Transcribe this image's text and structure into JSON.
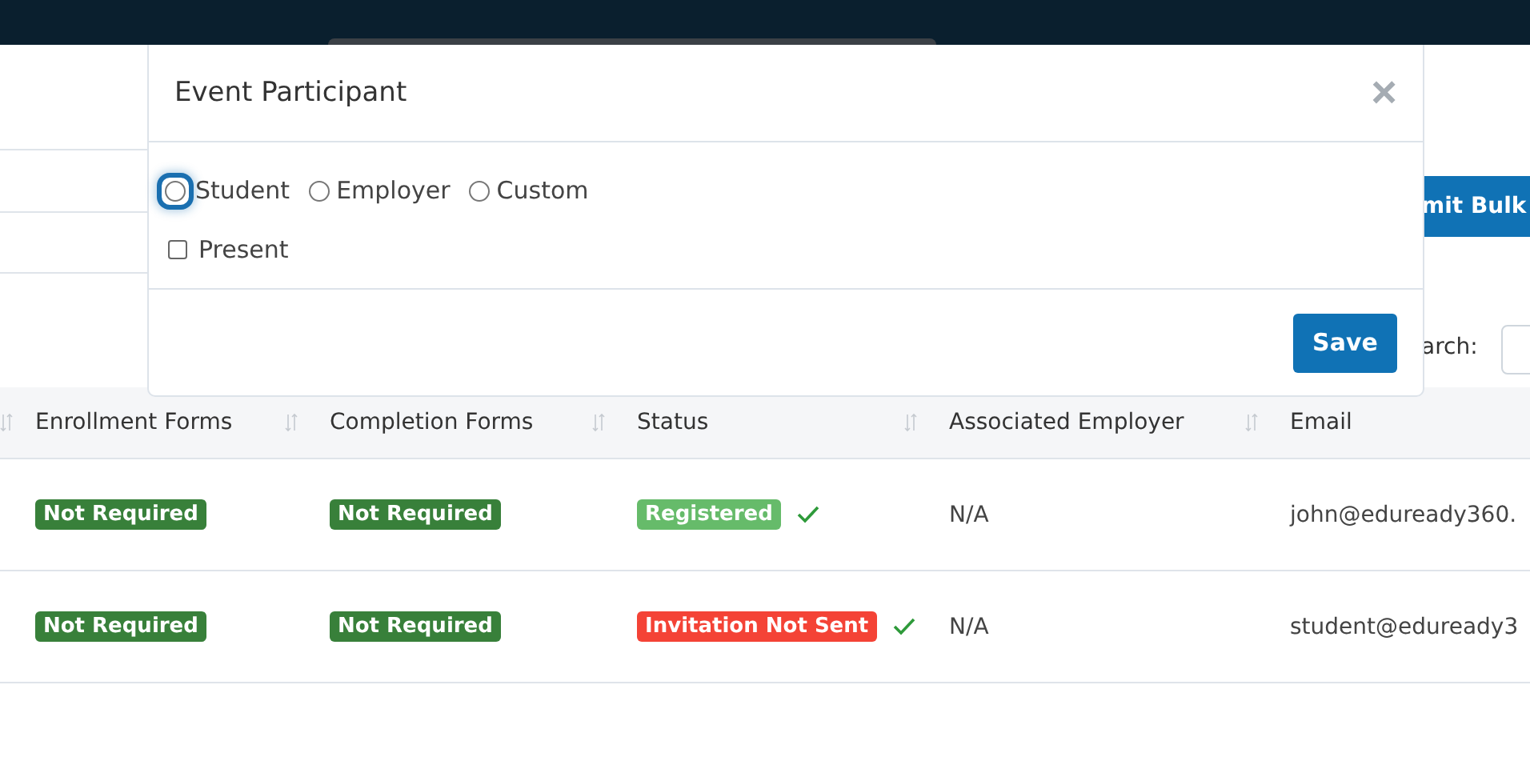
{
  "toolbar": {
    "submit_button": "mit Bulk",
    "search_label": "arch:"
  },
  "table": {
    "columns": [
      {
        "label": "Enrollment Forms"
      },
      {
        "label": "Completion Forms"
      },
      {
        "label": "Status"
      },
      {
        "label": "Associated Employer"
      },
      {
        "label": "Email"
      }
    ],
    "rows": [
      {
        "enrollment": {
          "text": "Not Required",
          "color": "#38803a"
        },
        "completion": {
          "text": "Not Required",
          "color": "#38803a"
        },
        "status": {
          "text": "Registered",
          "color": "#66bb6a"
        },
        "confirmed": true,
        "employer": "N/A",
        "email": "john@eduready360."
      },
      {
        "enrollment": {
          "text": "Not Required",
          "color": "#38803a"
        },
        "completion": {
          "text": "Not Required",
          "color": "#38803a"
        },
        "status": {
          "text": "Invitation Not Sent",
          "color": "#f44336"
        },
        "confirmed": true,
        "employer": "N/A",
        "email": "student@eduready3"
      }
    ]
  },
  "modal": {
    "title": "Event Participant",
    "close": "×",
    "participant_types": [
      {
        "label": "Student",
        "selected": false,
        "focused": true
      },
      {
        "label": "Employer",
        "selected": false,
        "focused": false
      },
      {
        "label": "Custom",
        "selected": false,
        "focused": false
      }
    ],
    "present": {
      "label": "Present",
      "checked": false
    },
    "save_button": "Save"
  }
}
